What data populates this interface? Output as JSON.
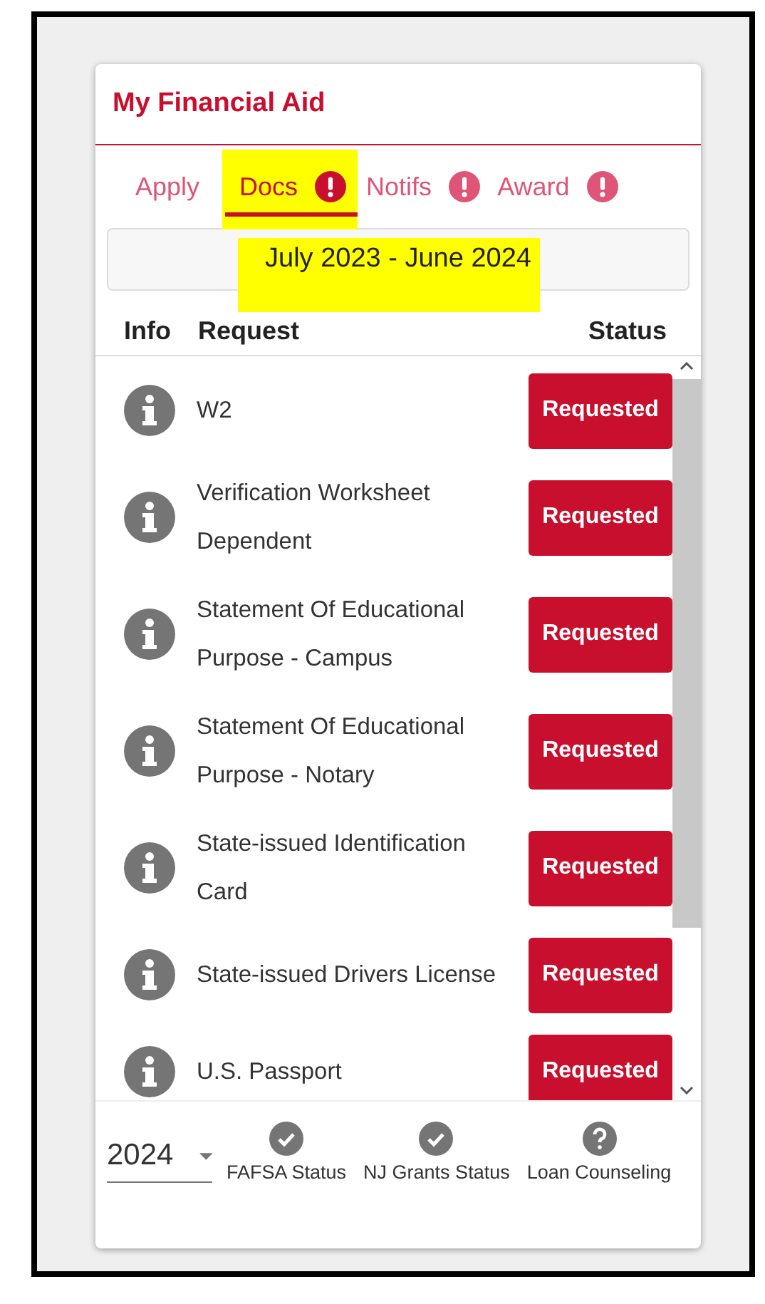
{
  "app": {
    "title": "My Financial Aid"
  },
  "tabs": [
    {
      "label": "Apply",
      "selected": false,
      "alert": false
    },
    {
      "label": "Docs",
      "selected": true,
      "alert": true
    },
    {
      "label": "Notifs",
      "selected": false,
      "alert": true
    },
    {
      "label": "Award",
      "selected": false,
      "alert": true
    }
  ],
  "period": "July 2023 - June 2024",
  "table": {
    "columns": [
      "Info",
      "Request",
      "Status"
    ],
    "rows": [
      {
        "request": "W2",
        "status": "Requested"
      },
      {
        "request": "Verification Worksheet Dependent",
        "status": "Requested"
      },
      {
        "request": "Statement Of Educational Purpose - Campus",
        "status": "Requested"
      },
      {
        "request": "Statement Of Educational Purpose - Notary",
        "status": "Requested"
      },
      {
        "request": "State-issued Identification Card",
        "status": "Requested"
      },
      {
        "request": "State-issued Drivers License",
        "status": "Requested"
      },
      {
        "request": "U.S. Passport",
        "status": "Requested"
      }
    ]
  },
  "footer": {
    "year": "2024",
    "links": [
      {
        "label": "FAFSA Status",
        "kind": "check"
      },
      {
        "label": "NJ Grants Status",
        "kind": "check"
      },
      {
        "label": "Loan Counseling",
        "kind": "question"
      }
    ]
  }
}
